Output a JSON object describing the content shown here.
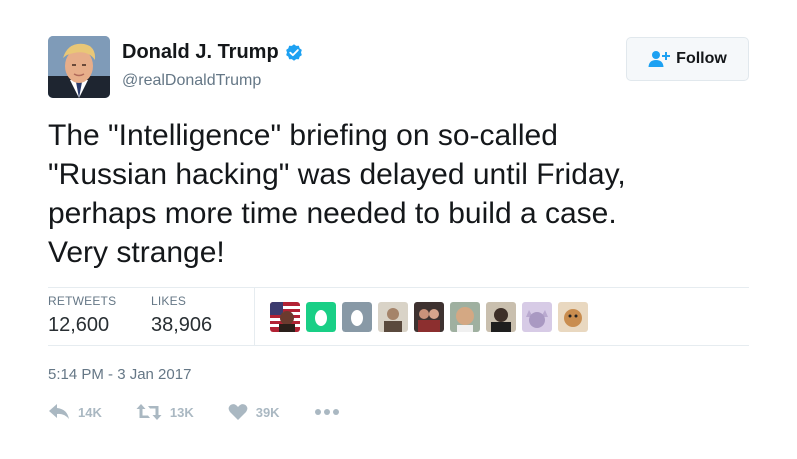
{
  "user": {
    "display_name": "Donald J. Trump",
    "handle": "@realDonaldTrump",
    "verified_icon": "verified-badge-icon",
    "avatar_icon": "avatar"
  },
  "follow_button": {
    "label": "Follow",
    "icon": "add-user-icon"
  },
  "tweet": {
    "text_lines": [
      "The \"Intelligence\" briefing on so-called",
      "\"Russian hacking\" was delayed until Friday,",
      "perhaps more time needed to build a case.",
      "Very strange!"
    ]
  },
  "stats": {
    "retweets_label": "RETWEETS",
    "retweets_value": "12,600",
    "likes_label": "LIKES",
    "likes_value": "38,906"
  },
  "likers": [
    {
      "name": "liker-avatar-flag",
      "color": "#6b3a2e"
    },
    {
      "name": "liker-avatar-egg-green",
      "color": "#19cf86"
    },
    {
      "name": "liker-avatar-egg-gray",
      "color": "#8899a6"
    },
    {
      "name": "liker-avatar-man",
      "color": "#7d6a55"
    },
    {
      "name": "liker-avatar-group",
      "color": "#4a3b36"
    },
    {
      "name": "liker-avatar-bald",
      "color": "#c9a07a"
    },
    {
      "name": "liker-avatar-dark",
      "color": "#5b5246"
    },
    {
      "name": "liker-avatar-cat",
      "color": "#b9a9cf"
    },
    {
      "name": "liker-avatar-dog",
      "color": "#c98d4f"
    }
  ],
  "timestamp": "5:14 PM - 3 Jan 2017",
  "actions": {
    "reply_count": "14K",
    "retweet_count": "13K",
    "like_count": "39K"
  },
  "colors": {
    "brand_blue": "#1da1f2",
    "muted": "#657786",
    "icon_gray": "#aab8c2",
    "text": "#14171a"
  }
}
